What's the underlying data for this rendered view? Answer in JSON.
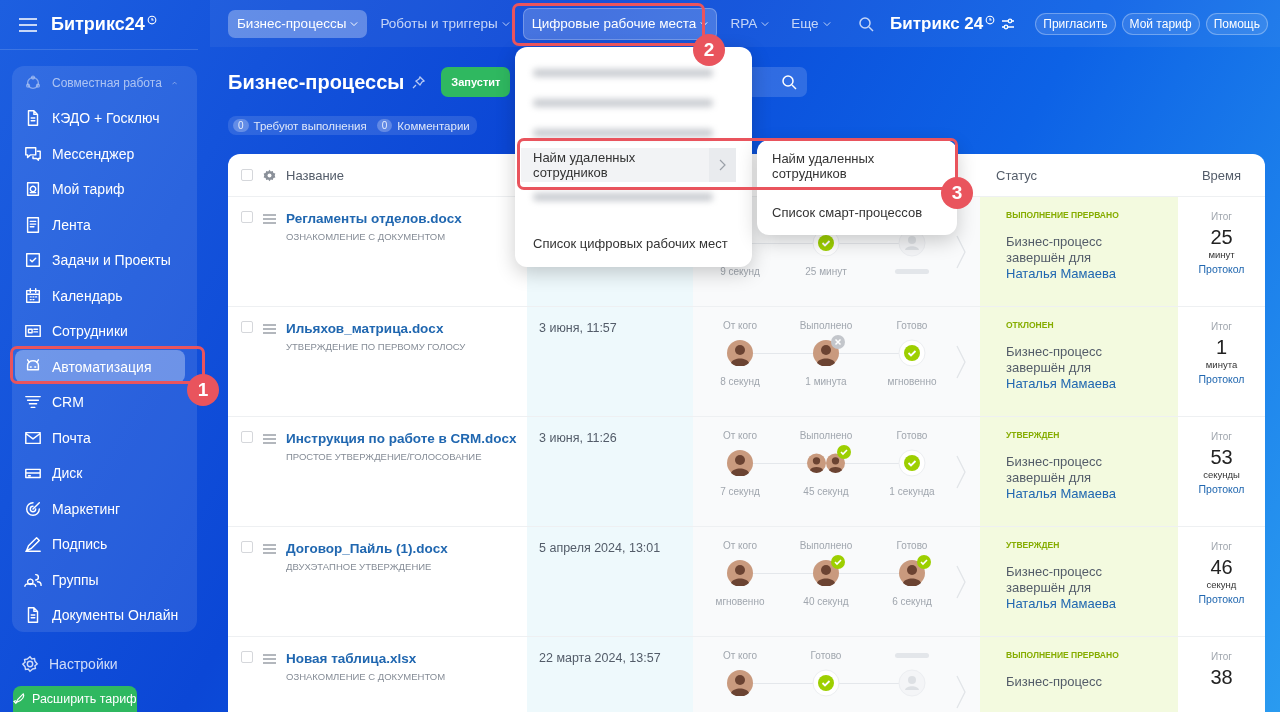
{
  "brand": {
    "name": "Битрикс24"
  },
  "sidebar": {
    "group": {
      "label": "Совместная работа",
      "expanded": true
    },
    "items": [
      {
        "label": "КЭДО + Госключ",
        "selected": false
      },
      {
        "label": "Мессенджер",
        "selected": false
      },
      {
        "label": "Мой тариф",
        "selected": false
      },
      {
        "label": "Лента",
        "selected": false
      },
      {
        "label": "Задачи и Проекты",
        "selected": false
      },
      {
        "label": "Календарь",
        "selected": false
      },
      {
        "label": "Сотрудники",
        "selected": false
      },
      {
        "label": "Автоматизация",
        "selected": true
      },
      {
        "label": "CRM",
        "selected": false
      },
      {
        "label": "Почта",
        "selected": false
      },
      {
        "label": "Диск",
        "selected": false
      },
      {
        "label": "Маркетинг",
        "selected": false
      },
      {
        "label": "Подпись",
        "selected": false
      },
      {
        "label": "Группы",
        "selected": false
      },
      {
        "label": "Документы Онлайн",
        "selected": false
      }
    ],
    "settings": "Настройки",
    "upgrade_button": "Расширить тариф"
  },
  "topbar": {
    "tabs": [
      {
        "label": "Бизнес-процессы",
        "selected": true,
        "open": false
      },
      {
        "label": "Роботы и триггеры",
        "selected": false,
        "open": false
      },
      {
        "label": "Цифровые рабочие места",
        "selected": false,
        "open": true
      },
      {
        "label": "RPA",
        "selected": false,
        "open": false
      },
      {
        "label": "Еще",
        "selected": false,
        "open": false
      }
    ],
    "logo": "Битрикс 24",
    "buttons": [
      "Пригласить",
      "Мой тариф",
      "Помощь"
    ]
  },
  "page": {
    "title": "Бизнес-процессы",
    "start_button": "Запустит",
    "counters": [
      {
        "count": "0",
        "label": "Требуют выполнения"
      },
      {
        "count": "0",
        "label": "Комментарии"
      }
    ]
  },
  "menu": {
    "items": [
      {
        "kind": "blurred"
      },
      {
        "kind": "blurred"
      },
      {
        "kind": "blurred"
      },
      {
        "kind": "item",
        "label": "Найм удаленных сотрудников",
        "submenu": true,
        "selected": true
      },
      {
        "kind": "blurred"
      },
      {
        "kind": "item",
        "label": "Список цифровых рабочих мест",
        "submenu": false,
        "selected": false
      }
    ]
  },
  "submenu": {
    "items": [
      "Найм удаленных сотрудников",
      "Список смарт-процессов"
    ]
  },
  "table": {
    "columns": [
      "Название",
      "Статус",
      "Время"
    ],
    "all_checked": false,
    "rows": [
      {
        "checked": false,
        "name": "Регламенты отделов.docx",
        "type": "ОЗНАКОМЛЕНИЕ С ДОКУМЕНТОМ",
        "steps": [
          {
            "kind": "none",
            "time": "9 секунд"
          },
          {
            "kind": "check",
            "time": "25 минут"
          },
          {
            "kind": "waiting"
          }
        ],
        "status": "ВЫПОЛНЕНИЕ ПРЕРВАНО",
        "status_text": "Бизнес-процесс завершён для ",
        "status_user": "Наталья Мамаева",
        "total_label": "Итог",
        "total": "25",
        "unit": "минут",
        "log_link": "Протокол"
      },
      {
        "checked": false,
        "name": "Ильяхов_матрица.docx",
        "type": "УТВЕРЖДЕНИЕ ПО ПЕРВОМУ ГОЛОСУ",
        "date": "3 июня, 11:57",
        "steps": [
          {
            "label": "От кого",
            "kind": "avatar",
            "approved": false,
            "declined": false,
            "time": "8 секунд"
          },
          {
            "label": "Выполнено",
            "kind": "avatar",
            "approved": false,
            "declined": true,
            "time": "1 минута"
          },
          {
            "label": "Готово",
            "kind": "check",
            "time": "мгновенно"
          }
        ],
        "status": "ОТКЛОНЕН",
        "status_text": "Бизнес-процесс завершён для ",
        "status_user": "Наталья Мамаева",
        "total_label": "Итог",
        "total": "1",
        "unit": "минута",
        "log_link": "Протокол"
      },
      {
        "checked": false,
        "name": "Инструкция по работе в CRM.docx",
        "type": "ПРОСТОЕ УТВЕРЖДЕНИЕ/ГОЛОСОВАНИЕ",
        "date": "3 июня, 11:26",
        "steps": [
          {
            "label": "От кого",
            "kind": "avatar",
            "approved": false,
            "declined": false,
            "time": "7 секунд"
          },
          {
            "label": "Выполнено",
            "kind": "group",
            "approved": true,
            "declined": false,
            "time": "45 секунд"
          },
          {
            "label": "Готово",
            "kind": "check",
            "time": "1 секунда"
          }
        ],
        "status": "УТВЕРЖДЕН",
        "status_text": "Бизнес-процесс завершён для ",
        "status_user": "Наталья Мамаева",
        "total_label": "Итог",
        "total": "53",
        "unit": "секунды",
        "log_link": "Протокол"
      },
      {
        "checked": false,
        "name": "Договор_Пайль (1).docx",
        "type": "ДВУХЭТАПНОЕ УТВЕРЖДЕНИЕ",
        "date": "5 апреля 2024, 13:01",
        "steps": [
          {
            "label": "От кого",
            "kind": "avatar",
            "approved": false,
            "declined": false,
            "time": "мгновенно"
          },
          {
            "label": "Выполнено",
            "kind": "avatar",
            "approved": true,
            "declined": false,
            "time": "40 секунд"
          },
          {
            "label": "Готово",
            "kind": "avatar",
            "approved": true,
            "declined": false,
            "time": "6 секунд"
          }
        ],
        "status": "УТВЕРЖДЕН",
        "status_text": "Бизнес-процесс завершён для ",
        "status_user": "Наталья Мамаева",
        "total_label": "Итог",
        "total": "46",
        "unit": "секунд",
        "log_link": "Протокол"
      },
      {
        "checked": false,
        "name": "Новая таблица.xlsx",
        "type": "ОЗНАКОМЛЕНИЕ С ДОКУМЕНТОМ",
        "date": "22 марта 2024, 13:57",
        "steps": [
          {
            "label": "От кого",
            "kind": "avatar",
            "approved": false,
            "declined": false
          },
          {
            "label": "Готово",
            "kind": "check"
          },
          {
            "kind": "skipped"
          }
        ],
        "status": "ВЫПОЛНЕНИЕ ПРЕРВАНО",
        "status_text": "Бизнес-процесс",
        "total_label": "Итог",
        "total": "38"
      }
    ]
  },
  "annotations": [
    {
      "number": "1"
    },
    {
      "number": "2"
    },
    {
      "number": "3"
    }
  ]
}
